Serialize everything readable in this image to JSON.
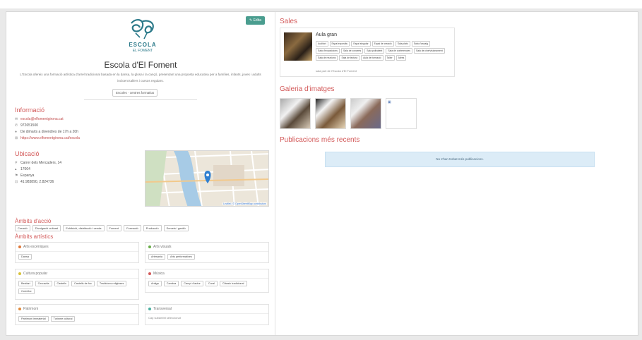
{
  "header": {
    "edit_button": "Edita",
    "title": "Escola d'El Foment",
    "logo_text": "ESCOLA",
    "logo_subtext": "EL FOMENT",
    "description": "L'Escola ofereix una formació artística d'arrel tradicional basada en la dansa, la glosa i la cançó, presentant una proposta educativa per a famílies, infants, joves i adults incloent tallers i cursos regulars.",
    "category": "Escoles · centres formatius"
  },
  "info": {
    "title": "Informació",
    "email": "escola@elfomentgirona.cat",
    "phone": "972651500",
    "hours": "De dimarts a divendres de 17h a 20h",
    "website": "https://www.elfomentgirona.cat/escola"
  },
  "location": {
    "title": "Ubicació",
    "address": "Carrer dels Mercaders, 14",
    "postal": "17004",
    "country": "Espanya",
    "coords": "41.983890, 2.824736",
    "map_attribution": "Leaflet | © OpenStreetMap contributors"
  },
  "ambits_acció": {
    "title": "Àmbits d'acció",
    "tags": [
      "Creació",
      "Divulgació cultural",
      "Exhibició, distribució i venda",
      "Foment",
      "Formació",
      "Producció",
      "Serveis i gestió"
    ]
  },
  "ambits_artistics": {
    "title": "Àmbits artístics",
    "boxes": [
      {
        "name": "Arts escèniques",
        "color": "#e07a3c",
        "tags": [
          "Dansa"
        ]
      },
      {
        "name": "Arts visuals",
        "color": "#6aae4a",
        "tags": [
          "Artesania",
          "Arts performatives"
        ]
      },
      {
        "name": "Cultura popular",
        "color": "#d8c23a",
        "tags": [
          "Bestiari",
          "Cercavila",
          "Castells",
          "Castells de foc",
          "Tradicions religioses",
          "Correfoc"
        ]
      },
      {
        "name": "Música",
        "color": "#d35a5a",
        "tags": [
          "Antiga",
          "Cambra",
          "Cançó d'autor",
          "Coral",
          "Clàssic tradicional"
        ]
      },
      {
        "name": "Patrimoni",
        "color": "#e08a3c",
        "tags": [
          "Patrimoni immaterial",
          "Turisme cultural"
        ]
      },
      {
        "name": "Transversal",
        "color": "#4ab0a0",
        "tags": [],
        "empty": "Cap subàmbit seleccionat"
      }
    ]
  },
  "sales": {
    "title": "Sales",
    "card": {
      "name": "Aula gran",
      "tags": [
        "Auditori",
        "Espai expositiu",
        "Espai singular",
        "Espai de creació",
        "Sala plató",
        "Sala d'assaig",
        "Sala d'exposicions",
        "Sala de concerts",
        "Sala polivalent",
        "Sala de conferències",
        "Sala de cine/visionament",
        "Sala de reunions",
        "Sala de lectura",
        "Aula de formació",
        "Taller",
        "Altres"
      ],
      "footer": "sala part de l'Escola d'El Foment"
    }
  },
  "gallery": {
    "title": "Galeria d'imatges",
    "broken_alt": ""
  },
  "publications": {
    "title": "Publicacions més recents",
    "empty": "No s'han trobat més publicacions."
  }
}
